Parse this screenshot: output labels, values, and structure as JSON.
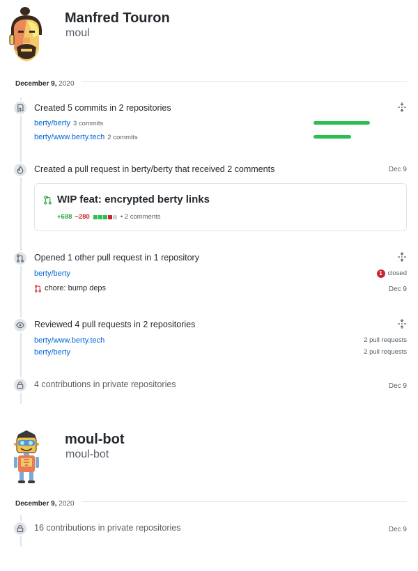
{
  "users": [
    {
      "name": "Manfred Touron",
      "login": "moul",
      "date": {
        "day": "December 9,",
        "year": "2020"
      },
      "commits": {
        "title": "Created 5 commits in 2 repositories",
        "repos": [
          {
            "name": "berty/berty",
            "meta": "3 commits",
            "share": 0.6
          },
          {
            "name": "berty/www.berty.tech",
            "meta": "2 commits",
            "share": 0.4
          }
        ]
      },
      "created_pr": {
        "title": "Created a pull request in berty/berty that received 2 comments",
        "date": "Dec 9",
        "pr_title": "WIP feat: encrypted berty links",
        "additions": "+688",
        "deletions": "−280",
        "comments": "• 2 comments"
      },
      "opened_pr": {
        "title": "Opened 1 other pull request in 1 repository",
        "repo": "berty/berty",
        "badge_count": "1",
        "state": "closed",
        "pr_title": "chore: bump deps",
        "date": "Dec 9"
      },
      "reviewed": {
        "title": "Reviewed 4 pull requests in 2 repositories",
        "repos": [
          {
            "name": "berty/www.berty.tech",
            "meta": "2 pull requests"
          },
          {
            "name": "berty/berty",
            "meta": "2 pull requests"
          }
        ]
      },
      "private": {
        "title": "4 contributions in private repositories",
        "date": "Dec 9"
      }
    },
    {
      "name": "moul-bot",
      "login": "moul-bot",
      "date": {
        "day": "December 9,",
        "year": "2020"
      },
      "private": {
        "title": "16 contributions in private repositories",
        "date": "Dec 9"
      }
    }
  ],
  "colors": {
    "link": "#0366d6",
    "green": "#2cbe4e",
    "red": "#cb2431",
    "timeline": "#e1e4e8"
  }
}
